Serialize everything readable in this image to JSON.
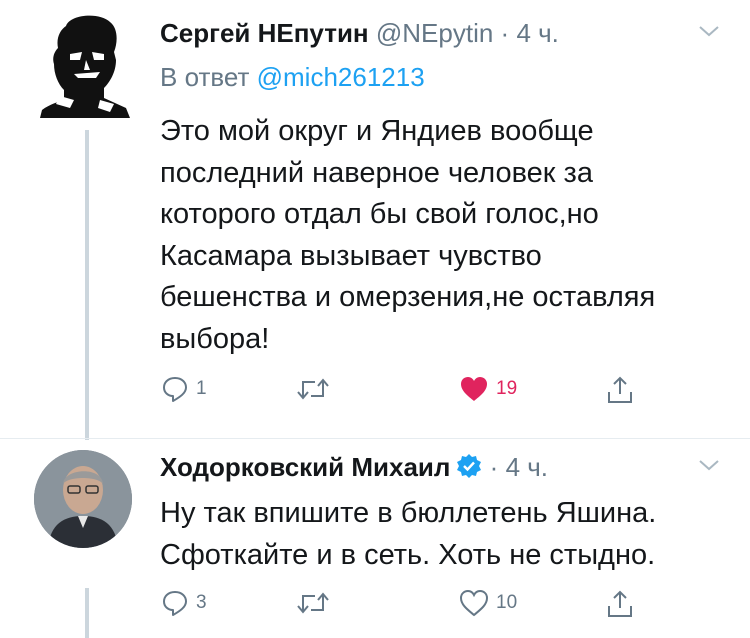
{
  "colors": {
    "accent": "#1da1f2",
    "like": "#e0245e",
    "muted": "#657786",
    "thread_line": "#ccd6dd"
  },
  "tweets": [
    {
      "name": "Сергей НЕпутин",
      "handle": "@NEpytin",
      "dot": "·",
      "time": "4 ч.",
      "reply_prefix": "В ответ",
      "reply_mention": "@mich261213",
      "text": "Это мой округ и Яндиев вообще\nпоследний наверное человек за\nкоторого отдал бы свой голос,но\nКасамара вызывает чувство\nбешенства и омерзения,не оставляя\nвыбора!",
      "actions": {
        "replies": "1",
        "retweets": "",
        "likes": "19",
        "liked": true
      },
      "icons": [
        "reply-icon",
        "retweet-icon",
        "heart-icon",
        "share-icon",
        "chevron-down-icon"
      ]
    },
    {
      "name": "Ходорковский Михаил",
      "verified": true,
      "dot": "·",
      "time": "4 ч.",
      "text": "Ну так впишите в бюллетень Яшина.\nСфоткайте и в сеть. Хоть не стыдно.",
      "actions": {
        "replies": "3",
        "retweets": "",
        "likes": "10",
        "liked": false
      },
      "icons": [
        "reply-icon",
        "retweet-icon",
        "heart-outline-icon",
        "share-icon",
        "chevron-down-icon"
      ]
    }
  ]
}
